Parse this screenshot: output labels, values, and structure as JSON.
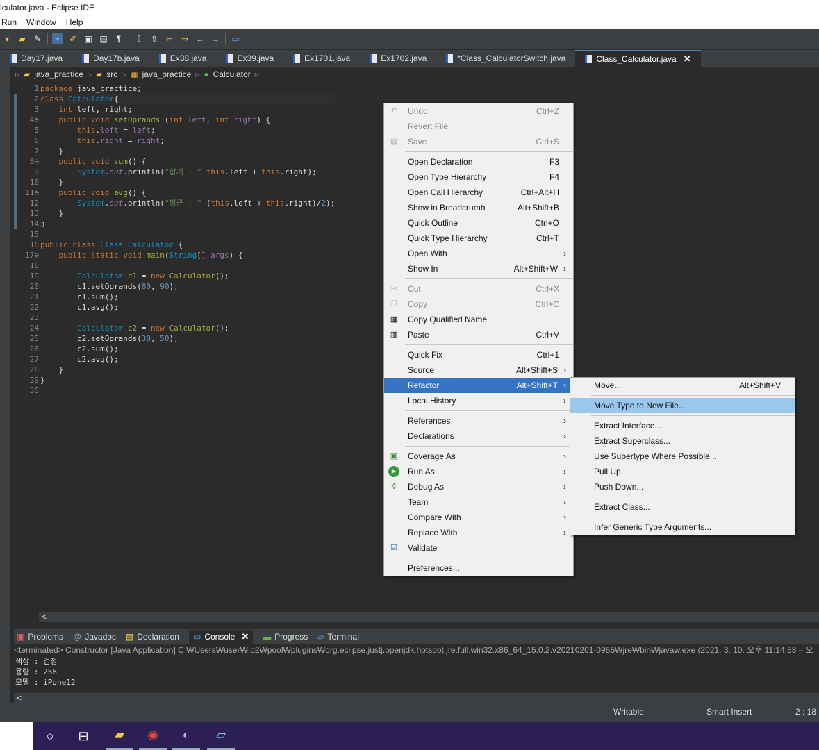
{
  "window": {
    "title": "lculator.java - Eclipse IDE"
  },
  "menu": [
    "Run",
    "Window",
    "Help"
  ],
  "tabs": [
    {
      "label": "Day17.java",
      "active": false
    },
    {
      "label": "Day17b.java",
      "active": false
    },
    {
      "label": "Ex38.java",
      "active": false
    },
    {
      "label": "Ex39.java",
      "active": false
    },
    {
      "label": "Ex1701.java",
      "active": false
    },
    {
      "label": "Ex1702.java",
      "active": false
    },
    {
      "label": "*Class_CalculatorSwitch.java",
      "active": false
    },
    {
      "label": "Class_Calculator.java",
      "active": true
    }
  ],
  "tab_close": "✕",
  "breadcrumb": [
    "java_practice",
    "src",
    "java_practice",
    "Calculator"
  ],
  "code": {
    "line_numbers": [
      "1",
      "2",
      "3",
      "4⊖",
      "5",
      "6",
      "7",
      "8⊖",
      "9",
      "10",
      "11⊖",
      "12",
      "13",
      "14",
      "15",
      "16",
      "17⊖",
      "18",
      "19",
      "20",
      "21",
      "22",
      "23",
      "24",
      "25",
      "26",
      "27",
      "28",
      "29",
      "30"
    ]
  },
  "context_menu": {
    "items": [
      {
        "label": "Undo",
        "shortcut": "Ctrl+Z",
        "disabled": true,
        "icon": "undo-icon"
      },
      {
        "label": "Revert File",
        "shortcut": "",
        "disabled": true
      },
      {
        "label": "Save",
        "shortcut": "Ctrl+S",
        "disabled": true,
        "icon": "save-icon"
      },
      {
        "sep": true
      },
      {
        "label": "Open Declaration",
        "shortcut": "F3"
      },
      {
        "label": "Open Type Hierarchy",
        "shortcut": "F4"
      },
      {
        "label": "Open Call Hierarchy",
        "shortcut": "Ctrl+Alt+H"
      },
      {
        "label": "Show in Breadcrumb",
        "shortcut": "Alt+Shift+B"
      },
      {
        "label": "Quick Outline",
        "shortcut": "Ctrl+O"
      },
      {
        "label": "Quick Type Hierarchy",
        "shortcut": "Ctrl+T"
      },
      {
        "label": "Open With",
        "shortcut": "",
        "submenu": true
      },
      {
        "label": "Show In",
        "shortcut": "Alt+Shift+W",
        "submenu": true
      },
      {
        "sep": true
      },
      {
        "label": "Cut",
        "shortcut": "Ctrl+X",
        "disabled": true,
        "icon": "cut-icon"
      },
      {
        "label": "Copy",
        "shortcut": "Ctrl+C",
        "disabled": true,
        "icon": "copy-icon"
      },
      {
        "label": "Copy Qualified Name",
        "shortcut": "",
        "icon": "copy-name-icon"
      },
      {
        "label": "Paste",
        "shortcut": "Ctrl+V",
        "icon": "paste-icon"
      },
      {
        "sep": true
      },
      {
        "label": "Quick Fix",
        "shortcut": "Ctrl+1"
      },
      {
        "label": "Source",
        "shortcut": "Alt+Shift+S",
        "submenu": true
      },
      {
        "label": "Refactor",
        "shortcut": "Alt+Shift+T",
        "submenu": true,
        "highlight": true
      },
      {
        "label": "Local History",
        "shortcut": "",
        "submenu": true
      },
      {
        "sep": true
      },
      {
        "label": "References",
        "shortcut": "",
        "submenu": true
      },
      {
        "label": "Declarations",
        "shortcut": "",
        "submenu": true
      },
      {
        "sep": true
      },
      {
        "label": "Coverage As",
        "shortcut": "",
        "submenu": true,
        "icon": "coverage-icon"
      },
      {
        "label": "Run As",
        "shortcut": "",
        "submenu": true,
        "icon": "run-icon"
      },
      {
        "label": "Debug As",
        "shortcut": "",
        "submenu": true,
        "icon": "debug-icon"
      },
      {
        "label": "Team",
        "shortcut": "",
        "submenu": true
      },
      {
        "label": "Compare With",
        "shortcut": "",
        "submenu": true
      },
      {
        "label": "Replace With",
        "shortcut": "",
        "submenu": true
      },
      {
        "label": "Validate",
        "shortcut": "",
        "icon": "checkbox-icon"
      },
      {
        "sep": true
      },
      {
        "label": "Preferences...",
        "shortcut": ""
      }
    ]
  },
  "refactor_menu": {
    "items": [
      {
        "label": "Move...",
        "shortcut": "Alt+Shift+V"
      },
      {
        "sep": true
      },
      {
        "label": "Move Type to New File...",
        "shortcut": "",
        "highlight": true
      },
      {
        "sep": true
      },
      {
        "label": "Extract Interface...",
        "shortcut": ""
      },
      {
        "label": "Extract Superclass...",
        "shortcut": ""
      },
      {
        "label": "Use Supertype Where Possible...",
        "shortcut": ""
      },
      {
        "label": "Pull Up...",
        "shortcut": ""
      },
      {
        "label": "Push Down...",
        "shortcut": ""
      },
      {
        "sep": true
      },
      {
        "label": "Extract Class...",
        "shortcut": ""
      },
      {
        "sep": true
      },
      {
        "label": "Infer Generic Type Arguments...",
        "shortcut": ""
      }
    ]
  },
  "bottom_tabs": [
    "Problems",
    "Javadoc",
    "Declaration",
    "Console",
    "Progress",
    "Terminal"
  ],
  "console": {
    "header": "<terminated> Constructor [Java Application] C:₩Users₩user₩.p2₩pool₩plugins₩org.eclipse.justj.openjdk.hotspot.jre.full.win32.x86_64_15.0.2.v20210201-0955₩jre₩bin₩javaw.exe  (2021. 3. 10. 오후 11:14:58 – 오",
    "lines": [
      "색상 : 검정",
      "용량 : 256",
      "모델 : iPone12"
    ]
  },
  "scroll_left": "<",
  "status": {
    "writable": "Writable",
    "insert": "Smart Insert",
    "position": "2 : 18"
  }
}
